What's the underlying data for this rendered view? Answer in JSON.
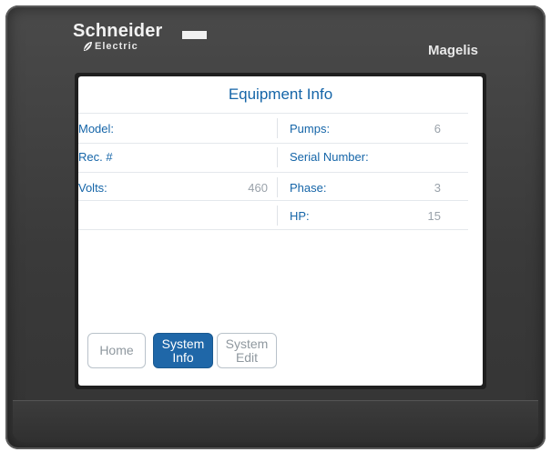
{
  "device": {
    "brand_name": "Schneider",
    "brand_sub": "Electric",
    "product_name": "Magelis"
  },
  "screen": {
    "title": "Equipment Info",
    "rows": [
      {
        "left_label": "Model:",
        "left_value": "",
        "right_label": "Pumps:",
        "right_value": "6"
      },
      {
        "left_label": "Rec. #",
        "left_value": "",
        "right_label": "Serial Number:",
        "right_value": ""
      },
      {
        "left_label": "Volts:",
        "left_value": "460",
        "right_label": "Phase:",
        "right_value": "3"
      },
      {
        "left_label": "",
        "left_value": "",
        "right_label": "HP:",
        "right_value": "15"
      }
    ],
    "nav": {
      "home_label": "Home",
      "system_info_line1": "System",
      "system_info_line2": "Info",
      "system_edit_line1": "System",
      "system_edit_line2": "Edit",
      "active": "system_info"
    }
  },
  "colors": {
    "accent": "#1565a8",
    "active_button": "#1f67a8",
    "value_text": "#9aa2aa",
    "bezel": "#3a3a3a"
  }
}
